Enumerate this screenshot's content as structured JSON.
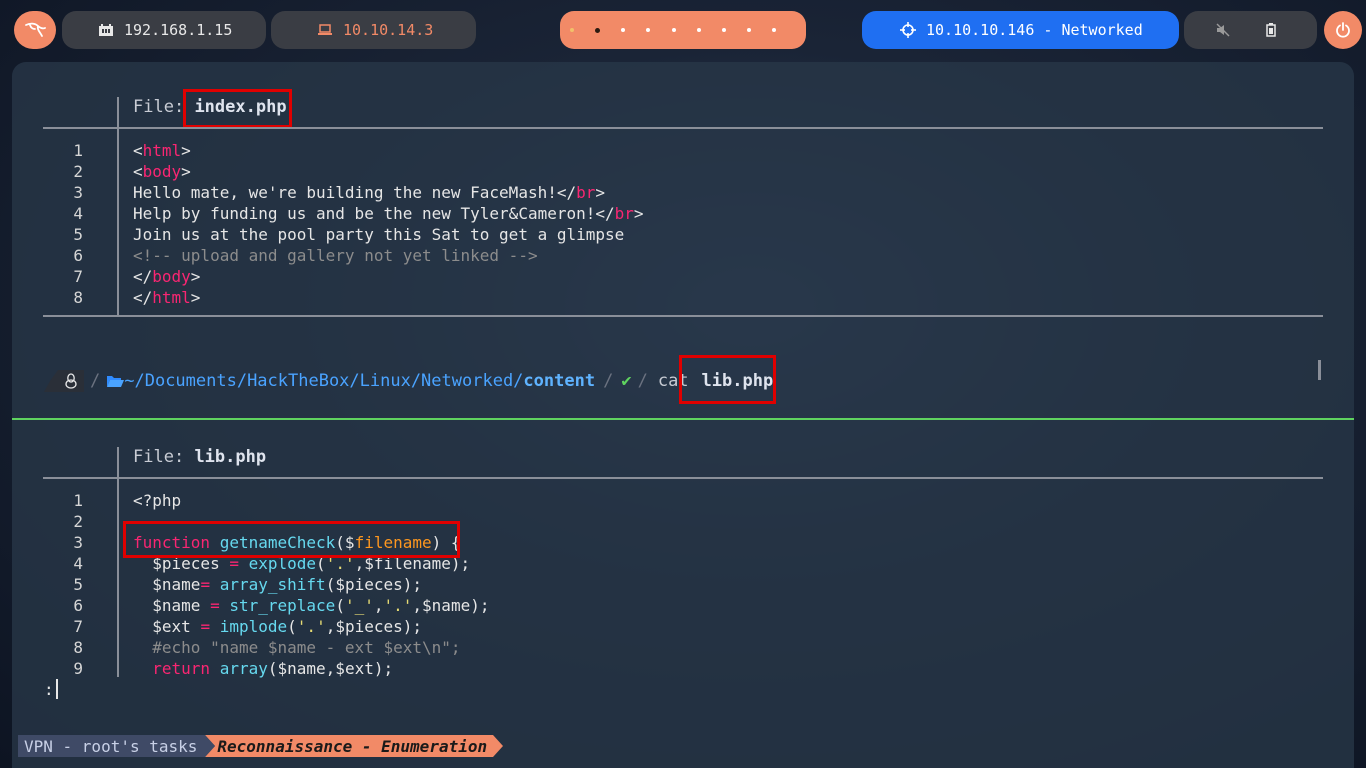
{
  "topbar": {
    "ip_local": "192.168.1.15",
    "ip_vpn": "10.10.14.3",
    "target": "10.10.10.146 - Networked",
    "workspaces": 10,
    "colors": {
      "orange": "#f28a67",
      "blue": "#1f6ff2",
      "dark": "#3a3d44"
    }
  },
  "file1": {
    "label": "File:",
    "name": "index.php",
    "lines": [
      {
        "n": "1",
        "html": "<span class='pl'>&lt;</span><span class='tag'>html</span>&gt;"
      },
      {
        "n": "2"
      },
      {
        "n": "3"
      },
      {
        "n": "4"
      },
      {
        "n": "5"
      },
      {
        "n": "6"
      },
      {
        "n": "7"
      },
      {
        "n": "8"
      }
    ]
  },
  "prompt": {
    "path_prefix": "~/Documents/HackTheBox/Linux/Networked/",
    "path_dir": "content",
    "check": "✔",
    "command": "cat",
    "arg": "lib.php"
  },
  "file2": {
    "label": "File:",
    "name": "lib.php"
  },
  "pager_prompt": ":",
  "bottom": {
    "left": "VPN - root's tasks",
    "right": "Reconnaissance - Enumeration"
  }
}
